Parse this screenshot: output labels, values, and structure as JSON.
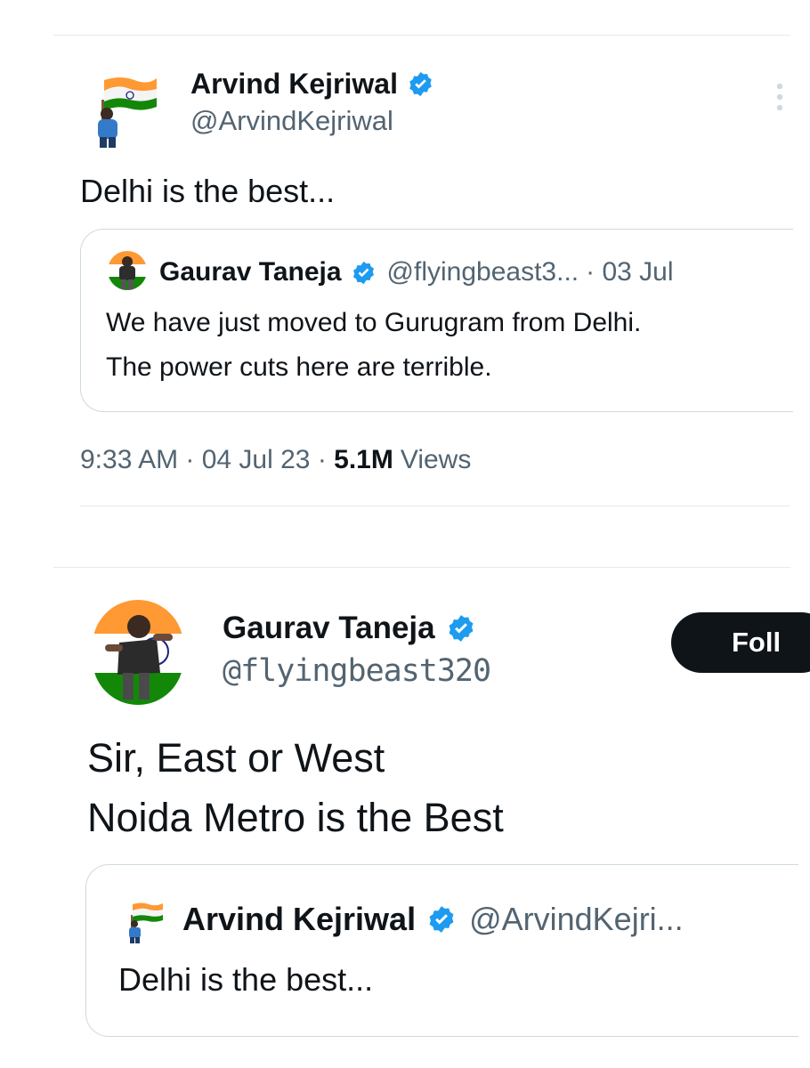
{
  "tweet1": {
    "author_name": "Arvind Kejriwal",
    "author_handle": "@ArvindKejriwal",
    "text": "Delhi is the best...",
    "more_icon": "more-vertical-icon",
    "quoted": {
      "author_name": "Gaurav Taneja",
      "author_handle": "@flyingbeast3...",
      "date": "· 03 Jul",
      "lines": [
        "We have just moved to Gurugram from Delhi.",
        "The power cuts here are terrible."
      ]
    },
    "meta": {
      "time_date": "9:33 AM · 04 Jul 23 · ",
      "views_count": "5.1M",
      "views_label": "Views"
    }
  },
  "tweet2": {
    "author_name": "Gaurav Taneja",
    "author_handle": "@flyingbeast320",
    "follow_label": "Foll",
    "lines": [
      "Sir, East or West",
      "Noida Metro is the Best"
    ],
    "quoted": {
      "author_name": "Arvind Kejriwal",
      "author_handle": "@ArvindKejri...",
      "text": "Delhi is the best..."
    }
  },
  "colors": {
    "verified": "#1d9bf0",
    "saffron": "#ff9933",
    "india_green": "#138808",
    "text_primary": "#0f1419",
    "text_secondary": "#536471"
  }
}
